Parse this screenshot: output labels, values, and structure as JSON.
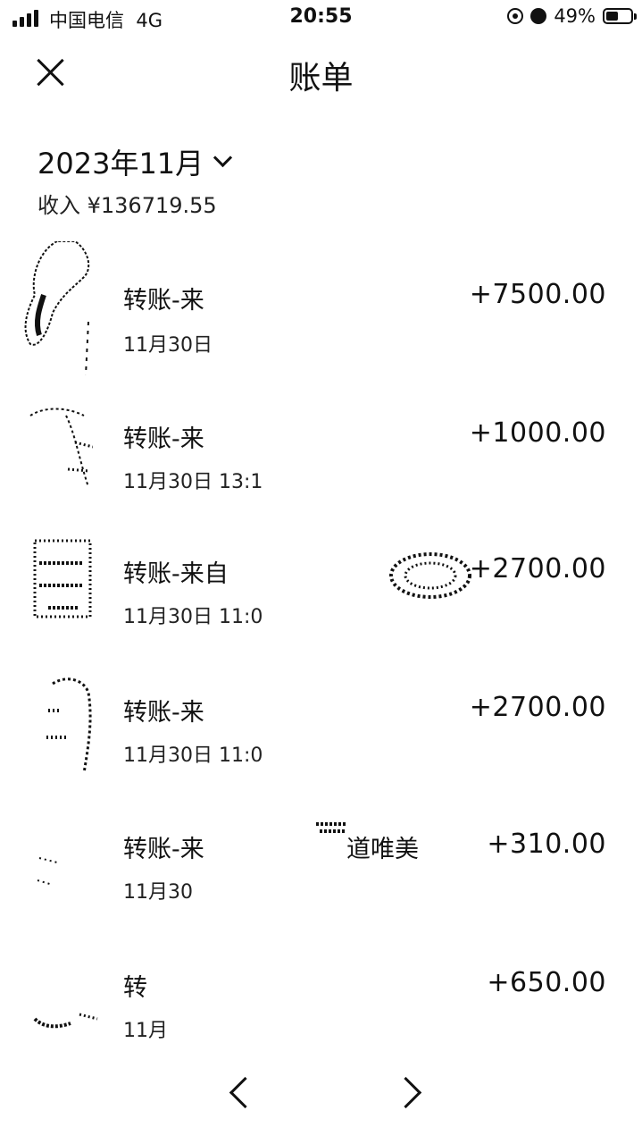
{
  "status_bar": {
    "carrier": "中国电信",
    "network": "4G",
    "time": "20:55",
    "battery": "49%",
    "battery_level": 0.49
  },
  "header": {
    "title": "账单"
  },
  "summary": {
    "month": "2023年11月",
    "income": "收入 ¥136719.55"
  },
  "transactions": [
    {
      "desc": "转账-来",
      "time": "11月30日",
      "amount": "+7500.00"
    },
    {
      "desc": "转账-来",
      "time": "11月30日 13:1",
      "amount": "+1000.00"
    },
    {
      "desc": "转账-来自",
      "time": "11月30日 11:0",
      "amount": "+2700.00"
    },
    {
      "desc": "转账-来",
      "time": "11月30日 11:0",
      "amount": "+2700.00"
    },
    {
      "desc": "转账-来",
      "suffix": "道唯美",
      "time": "11月30",
      "amount": "+310.00"
    },
    {
      "desc": "转",
      "time": "11月",
      "amount": "+650.00"
    }
  ]
}
